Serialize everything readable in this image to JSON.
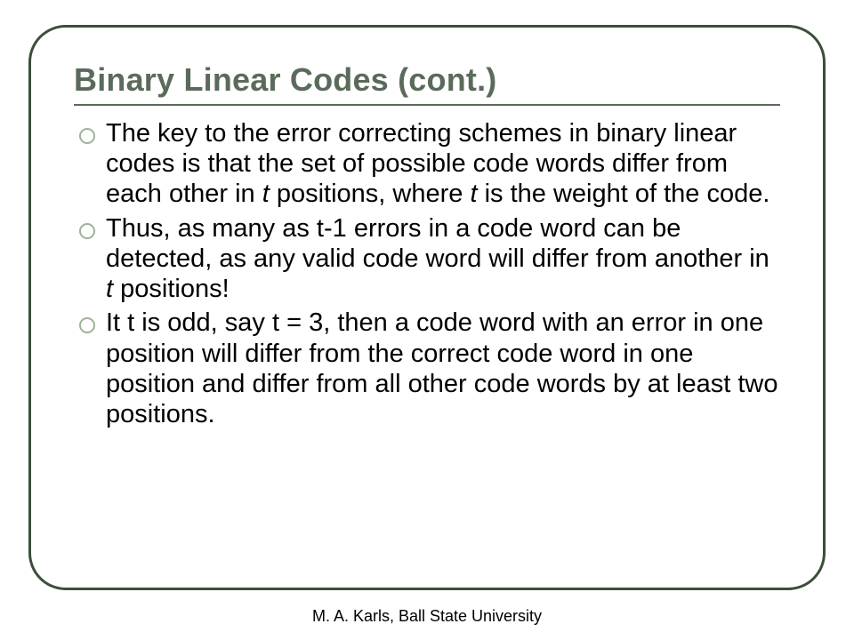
{
  "title": "Binary Linear Codes (cont.)",
  "bullets": {
    "b1a": "The key to the error correcting schemes in binary linear codes is that the set of possible code words differ from each other in ",
    "b1b": "t",
    "b1c": " positions, where ",
    "b1d": "t",
    "b1e": " is the weight of the code.",
    "b2a": "Thus, as many as t-1 errors in a code word can be detected, as any valid code word will differ from another in ",
    "b2b": "t",
    "b2c": " positions!",
    "b3": "It t is odd, say t = 3, then a code word with an error in one position will differ from the correct code word in one position and differ from all other code words by at least two positions."
  },
  "footer": "M. A. Karls, Ball State University"
}
